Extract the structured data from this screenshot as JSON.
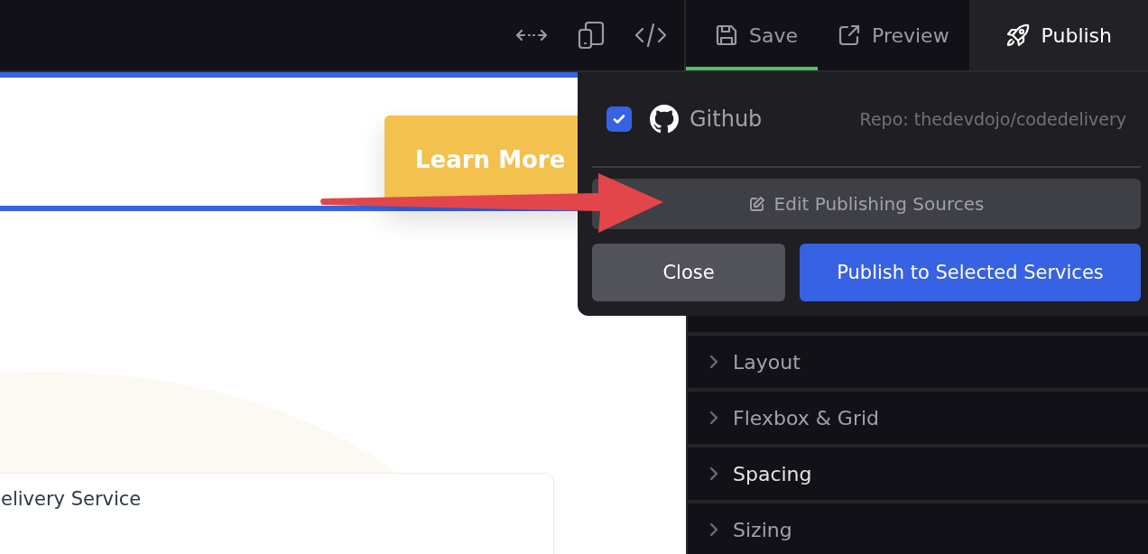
{
  "toolbar": {
    "tabs": [
      {
        "label": "Save",
        "kind": "save",
        "selected": true,
        "expanded": false
      },
      {
        "label": "Preview",
        "kind": "preview",
        "selected": false,
        "expanded": false
      },
      {
        "label": "Publish",
        "kind": "publish",
        "selected": false,
        "expanded": true
      }
    ]
  },
  "canvas": {
    "button": "Learn More",
    "card_title": "elivery Service"
  },
  "publish_popup": {
    "services": [
      {
        "name": "Github",
        "repo": "Repo: thedevdojo/codedelivery",
        "checked": true
      }
    ],
    "edit_button": "Edit Publishing Sources",
    "close_button": "Close",
    "publish_button": "Publish to Selected Services"
  },
  "sidebar": {
    "sections": [
      {
        "label": "Layout",
        "expanded": false,
        "highlighted": false
      },
      {
        "label": "Flexbox & Grid",
        "expanded": false,
        "highlighted": false
      },
      {
        "label": "Spacing",
        "expanded": false,
        "highlighted": true
      },
      {
        "label": "Sizing",
        "expanded": false,
        "highlighted": false
      }
    ]
  }
}
